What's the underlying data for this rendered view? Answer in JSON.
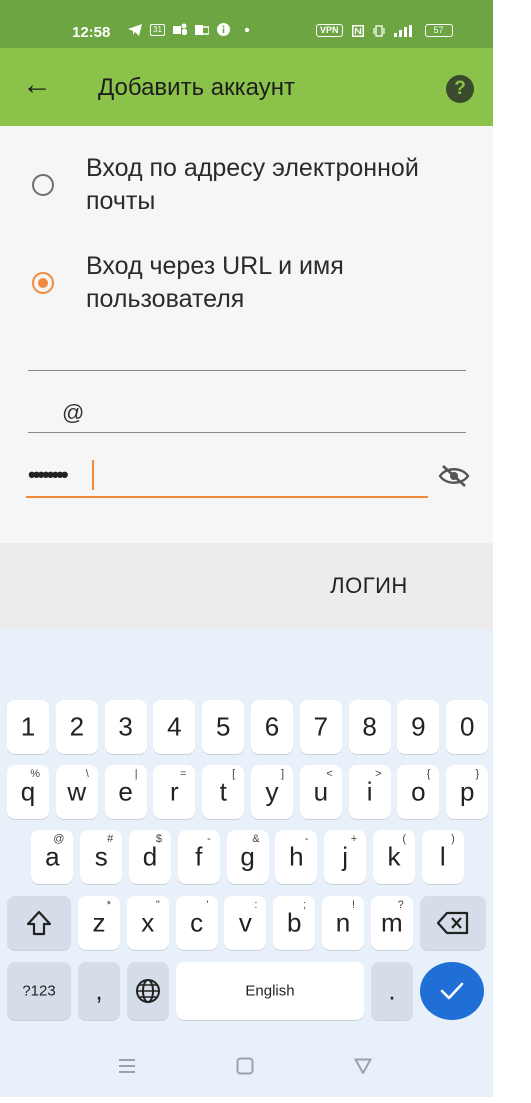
{
  "status_bar": {
    "time": "12:58",
    "left_icons": [
      "telegram-icon",
      "calendar-icon",
      "teams-icon",
      "outlook-icon",
      "info-icon",
      "dot-icon"
    ],
    "calendar_day": "31",
    "vpn": "VPN",
    "battery": "57"
  },
  "app_bar": {
    "title": "Добавить аккаунт",
    "back_icon": "←",
    "help_icon": "?"
  },
  "login_options": [
    {
      "label": "Вход по адресу электронной почты",
      "checked": false
    },
    {
      "label": "Вход через URL и имя пользователя",
      "checked": true
    }
  ],
  "fields": {
    "url_value": "",
    "username_value": "@",
    "password_mask": "••••••••"
  },
  "login_button": "ЛОГИН",
  "keyboard": {
    "numbers": [
      "1",
      "2",
      "3",
      "4",
      "5",
      "6",
      "7",
      "8",
      "9",
      "0"
    ],
    "row1": [
      {
        "k": "q",
        "h": "%"
      },
      {
        "k": "w",
        "h": "\\"
      },
      {
        "k": "e",
        "h": "|"
      },
      {
        "k": "r",
        "h": "="
      },
      {
        "k": "t",
        "h": "["
      },
      {
        "k": "y",
        "h": "]"
      },
      {
        "k": "u",
        "h": "<"
      },
      {
        "k": "i",
        "h": ">"
      },
      {
        "k": "o",
        "h": "{"
      },
      {
        "k": "p",
        "h": "}"
      }
    ],
    "row2": [
      {
        "k": "a",
        "h": "@"
      },
      {
        "k": "s",
        "h": "#"
      },
      {
        "k": "d",
        "h": "$"
      },
      {
        "k": "f",
        "h": "-"
      },
      {
        "k": "g",
        "h": "&"
      },
      {
        "k": "h",
        "h": "-"
      },
      {
        "k": "j",
        "h": "+"
      },
      {
        "k": "k",
        "h": "("
      },
      {
        "k": "l",
        "h": ")"
      }
    ],
    "row3": [
      {
        "k": "z",
        "h": "*"
      },
      {
        "k": "x",
        "h": "\""
      },
      {
        "k": "c",
        "h": "'"
      },
      {
        "k": "v",
        "h": ":"
      },
      {
        "k": "b",
        "h": ";"
      },
      {
        "k": "n",
        "h": "!"
      },
      {
        "k": "m",
        "h": "?"
      }
    ],
    "sym_key": "?123",
    "comma_key": ",",
    "space_label": "English",
    "period_key": "."
  }
}
